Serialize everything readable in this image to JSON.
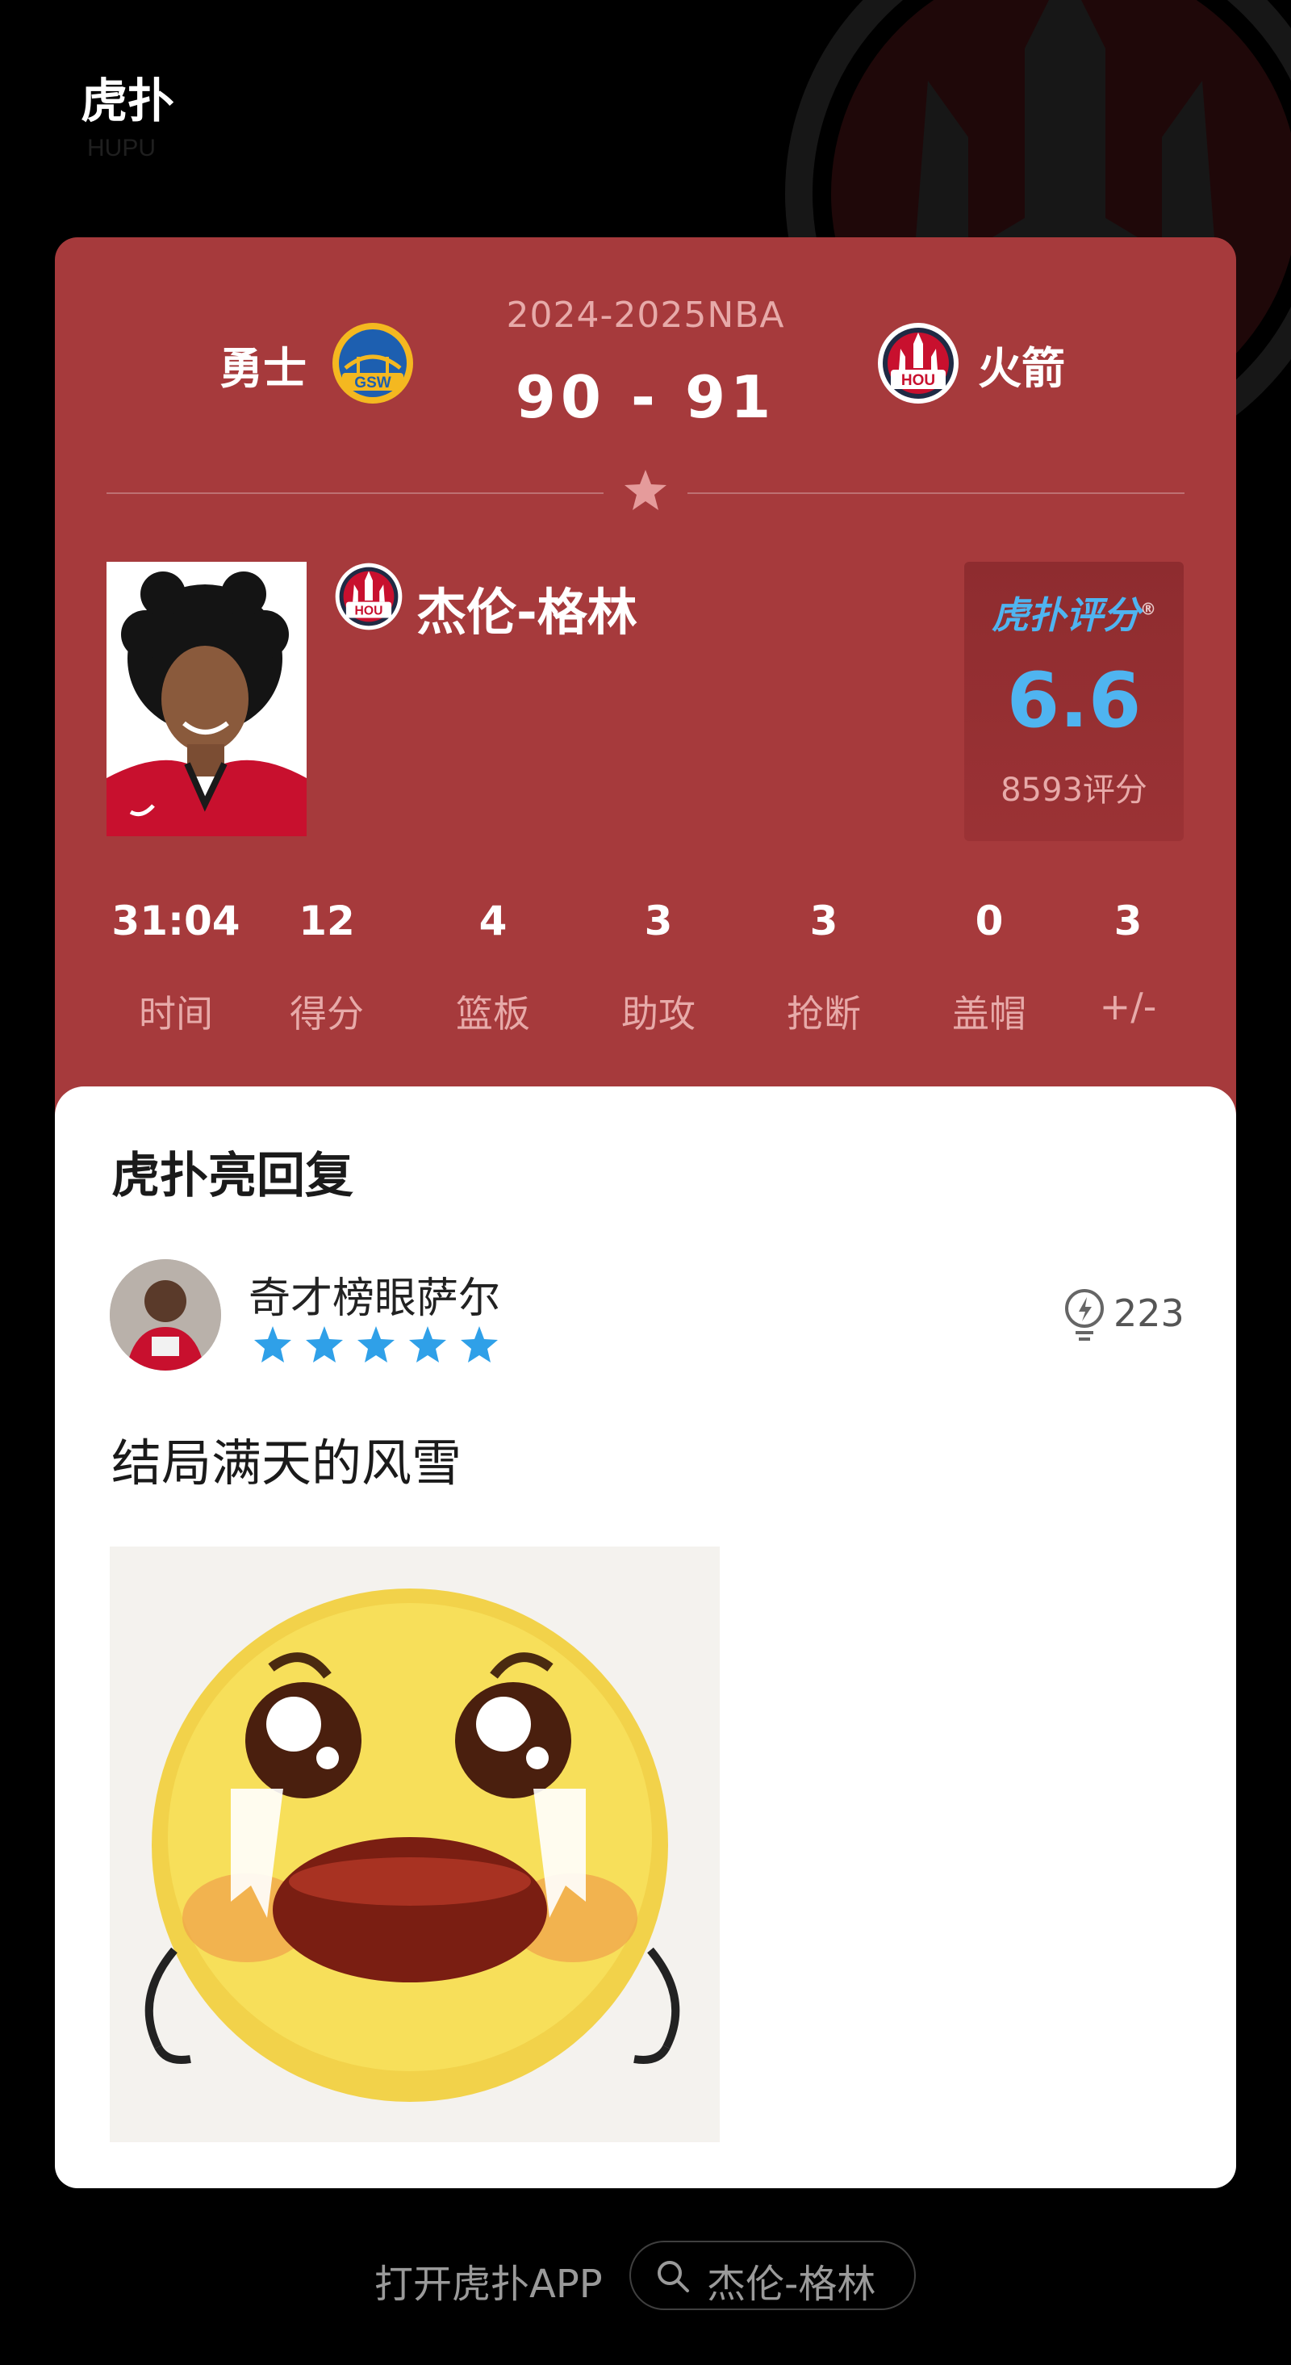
{
  "header": {
    "app_logo": "虎扑",
    "app_logo_icon": "hupu-logo-icon",
    "background_icon": "rockets-logo-background"
  },
  "game": {
    "season": "2024-2025NBA",
    "score": "90 - 91",
    "home_team": {
      "name": "勇士",
      "badge_text": "GSW",
      "icon": "warriors-logo-icon"
    },
    "away_team": {
      "name": "火箭",
      "badge_text": "HOU",
      "icon": "rockets-logo-icon"
    }
  },
  "player": {
    "name": "杰伦-格林",
    "team_badge_text": "HOU",
    "rating_brand": "虎扑评分",
    "rating_mark": "®",
    "rating": "6.6",
    "rating_count": "8593评分"
  },
  "stats": [
    {
      "value": "31:04",
      "label": "时间"
    },
    {
      "value": "12",
      "label": "得分"
    },
    {
      "value": "4",
      "label": "篮板"
    },
    {
      "value": "3",
      "label": "助攻"
    },
    {
      "value": "3",
      "label": "抢断"
    },
    {
      "value": "0",
      "label": "盖帽"
    },
    {
      "value": "3",
      "label": "+/-"
    }
  ],
  "reply": {
    "section_title": "虎扑亮回复",
    "user_name": "奇才榜眼萨尔",
    "stars": 5,
    "light_count": "223",
    "text": "结局满天的风雪"
  },
  "footer": {
    "open_app": "打开虎扑APP",
    "search_query": "杰伦-格林"
  },
  "colors": {
    "card_red": "#a63a3c",
    "rating_blue": "#4fb4f0",
    "star_blue": "#2fa0e8"
  }
}
